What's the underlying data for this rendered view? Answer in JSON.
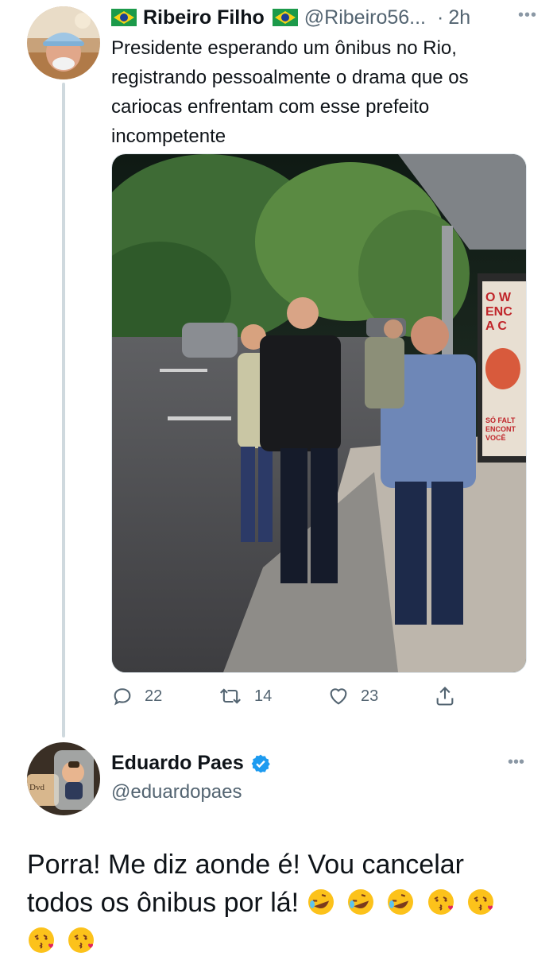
{
  "thread": {
    "parent": {
      "author_name": "Ribeiro Filho",
      "handle": "@Ribeiro56...",
      "separator": "·",
      "time": "2h",
      "text": "Presidente esperando um ônibus no Rio, registrando pessoalmente o drama que os cariocas enfrentam com esse prefeito incompetente",
      "flag_icon": "brazil-flag-icon",
      "media": {
        "billboard_text_1": "O W",
        "billboard_text_2": "ENC",
        "billboard_text_3": "A C",
        "billboard_text_4": "SÓ FALT",
        "billboard_text_5": "ENCONT",
        "billboard_text_6": "VOCÊ"
      },
      "actions": {
        "reply_count": "22",
        "retweet_count": "14",
        "like_count": "23"
      }
    },
    "reply": {
      "author_name": "Eduardo Paes",
      "handle": "@eduardopaes",
      "text": "Porra!  Me diz aonde é!  Vou cancelar todos os ônibus por lá!",
      "emojis": [
        "rolling-laughing",
        "rolling-laughing",
        "rolling-laughing",
        "kissing-heart",
        "kissing-heart",
        "kissing-heart",
        "kissing-heart"
      ]
    }
  },
  "colors": {
    "text": "#0f1419",
    "secondary": "#536471",
    "verified": "#1d9bf0",
    "thread_line": "#cfd9de"
  }
}
